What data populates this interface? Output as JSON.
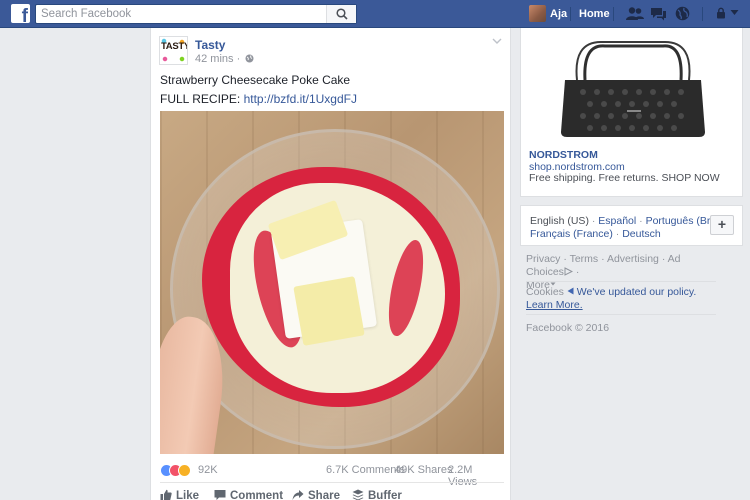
{
  "topbar": {
    "logo": "f",
    "search_placeholder": "Search Facebook",
    "user_name": "Aja",
    "home_label": "Home",
    "icons": [
      "friend-requests-icon",
      "messages-icon",
      "notifications-globe-icon",
      "privacy-lock-icon",
      "account-menu-caret-icon"
    ],
    "brand_color": "#3b5998"
  },
  "post": {
    "page_name": "Tasty",
    "page_avatar_text": "TASTY",
    "time": "42 mins ·",
    "title": "Strawberry Cheesecake Poke Cake",
    "recipe_prefix": "FULL RECIPE:",
    "recipe_link": "http://bzfd.it/1UxgdFJ",
    "reaction_count": "92K",
    "comments": "6.7K Comments",
    "shares": "49K Shares",
    "views": "2.2M Views",
    "actions": {
      "like": "Like",
      "comment": "Comment",
      "share": "Share",
      "buffer": "Buffer"
    }
  },
  "ad": {
    "brand": "NORDSTROM",
    "url": "shop.nordstrom.com",
    "text": "Free shipping. Free returns. SHOP NOW"
  },
  "languages": {
    "current": "English (US)",
    "options": [
      "Español",
      "Português (Brasil)",
      "Français (France)",
      "Deutsch"
    ],
    "add_label": "+"
  },
  "footer": {
    "privacy": "Privacy",
    "terms": "Terms",
    "advertising": "Advertising",
    "ad_choices": "Ad Choices",
    "more": "More",
    "cookies_label": "Cookies",
    "cookies_updated": "We've updated our policy.",
    "learn_more": "Learn More.",
    "copyright": "Facebook © 2016"
  }
}
